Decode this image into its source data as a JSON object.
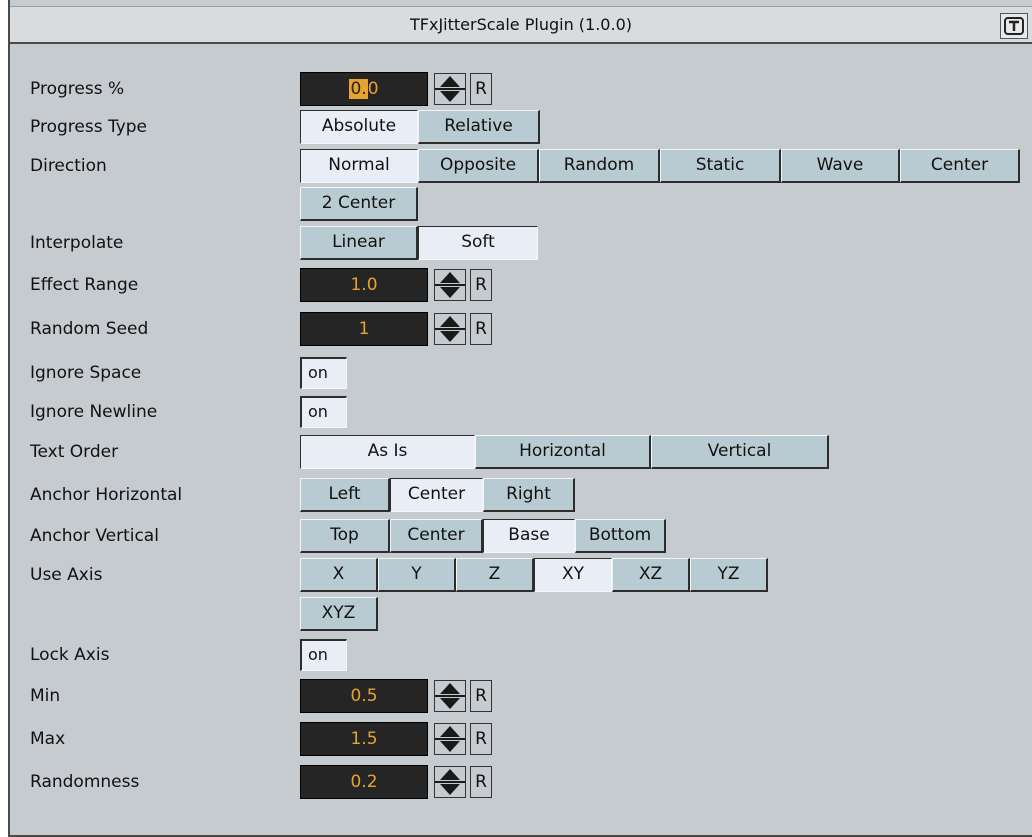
{
  "panel": {
    "title": "TFxJitterScale Plugin (1.0.0)",
    "title_icon": "plugin-icon"
  },
  "fields": {
    "progress": {
      "label": "Progress %",
      "value_hl": "0.",
      "value_rest": "0",
      "reset": "R"
    },
    "progress_type": {
      "label": "Progress Type",
      "options": [
        "Absolute",
        "Relative"
      ],
      "selected": "Absolute"
    },
    "direction": {
      "label": "Direction",
      "options": [
        "Normal",
        "Opposite",
        "Random",
        "Static",
        "Wave",
        "Center",
        "2 Center"
      ],
      "selected": "Normal"
    },
    "interpolate": {
      "label": "Interpolate",
      "options": [
        "Linear",
        "Soft"
      ],
      "selected": "Soft"
    },
    "effect_range": {
      "label": "Effect Range",
      "value": "1.0",
      "reset": "R"
    },
    "random_seed": {
      "label": "Random Seed",
      "value": "1",
      "reset": "R"
    },
    "ignore_space": {
      "label": "Ignore Space",
      "value": "on"
    },
    "ignore_newline": {
      "label": "Ignore Newline",
      "value": "on"
    },
    "text_order": {
      "label": "Text Order",
      "options": [
        "As Is",
        "Horizontal",
        "Vertical"
      ],
      "selected": "As Is"
    },
    "anchor_h": {
      "label": "Anchor Horizontal",
      "options": [
        "Left",
        "Center",
        "Right"
      ],
      "selected": "Center"
    },
    "anchor_v": {
      "label": "Anchor Vertical",
      "options": [
        "Top",
        "Center",
        "Base",
        "Bottom"
      ],
      "selected": "Base"
    },
    "use_axis": {
      "label": "Use Axis",
      "options": [
        "X",
        "Y",
        "Z",
        "XY",
        "XZ",
        "YZ",
        "XYZ"
      ],
      "selected": "XY"
    },
    "lock_axis": {
      "label": "Lock Axis",
      "value": "on"
    },
    "min": {
      "label": "Min",
      "value": "0.5",
      "reset": "R"
    },
    "max": {
      "label": "Max",
      "value": "1.5",
      "reset": "R"
    },
    "randomness": {
      "label": "Randomness",
      "value": "0.2",
      "reset": "R"
    }
  },
  "colors": {
    "panel_bg": "#c6cbd0",
    "button_bg": "#b8cbd3",
    "selected_bg": "#e9edf6",
    "number_bg": "#252525",
    "number_text": "#e8a22e"
  }
}
